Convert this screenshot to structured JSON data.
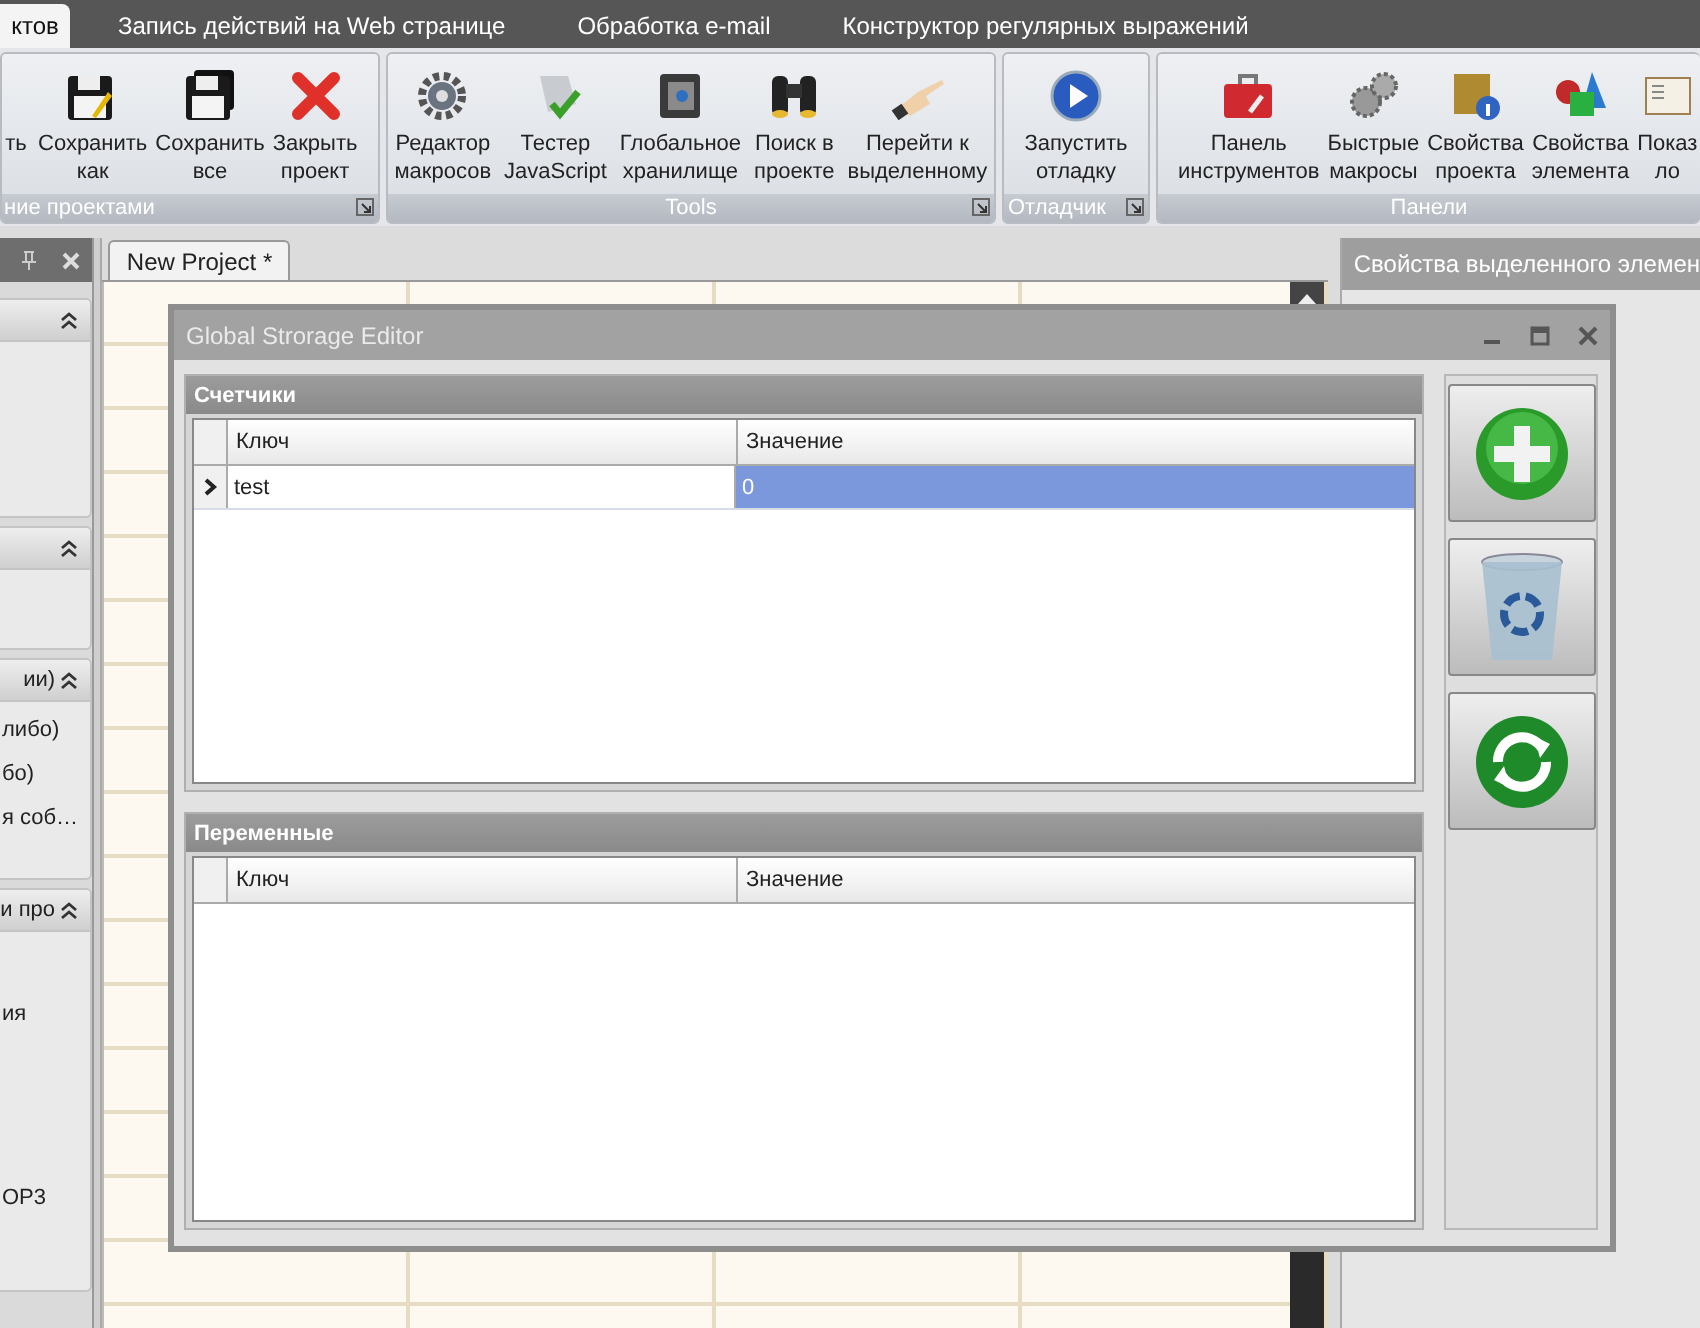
{
  "top_tabs": [
    {
      "label": "ктов",
      "selected": true
    },
    {
      "label": "Запись действий на Web странице",
      "selected": false
    },
    {
      "label": "Обработка e-mail",
      "selected": false
    },
    {
      "label": "Конструктор регулярных выражений",
      "selected": false
    }
  ],
  "ribbon": {
    "groups": [
      {
        "label": "ние проектами",
        "launcher": true,
        "items": [
          {
            "kind": "none",
            "label": "ть"
          },
          {
            "kind": "save",
            "label": "Сохранить\nкак"
          },
          {
            "kind": "save-all",
            "label": "Сохранить\nвсе"
          },
          {
            "kind": "close",
            "label": "Закрыть\nпроект"
          }
        ]
      },
      {
        "label": "Tools",
        "launcher": true,
        "items": [
          {
            "kind": "gear",
            "label": "Редактор\nмакросов"
          },
          {
            "kind": "tester",
            "label": "Тестер\nJavaScript"
          },
          {
            "kind": "safe",
            "label": "Глобальное\nхранилище"
          },
          {
            "kind": "binoculars",
            "label": "Поиск в\nпроекте"
          },
          {
            "kind": "hand",
            "label": "Перейти к\nвыделенному"
          }
        ]
      },
      {
        "label": "Отладчик",
        "launcher": true,
        "items": [
          {
            "kind": "play",
            "label": "Запустить\nотладку"
          }
        ]
      },
      {
        "label": "Панели",
        "launcher": false,
        "items": [
          {
            "kind": "toolbox",
            "label": "Панель\nинструментов"
          },
          {
            "kind": "gears",
            "label": "Быстрые\nмакросы"
          },
          {
            "kind": "crate",
            "label": "Свойства\nпроекта"
          },
          {
            "kind": "shapes",
            "label": "Свойства\nэлемента"
          },
          {
            "kind": "book",
            "label": "Показ\nло"
          }
        ]
      }
    ]
  },
  "left_panel": {
    "sections": [
      {
        "expanded": true
      },
      {
        "expanded": true
      },
      {
        "title": "ии)",
        "expanded": true,
        "items": [
          "либо)",
          "бо)",
          "я соб…"
        ]
      },
      {
        "title": "и про",
        "expanded": true,
        "items": [
          "ия",
          "ОР3"
        ]
      }
    ]
  },
  "document": {
    "tab": {
      "label": "New Project *",
      "selected": true
    }
  },
  "right_panel": {
    "title": "Свойства выделенного элемен"
  },
  "dialog": {
    "title": "Global Strorage Editor",
    "groups": [
      {
        "title": "Счетчики",
        "columns": [
          "Ключ",
          "Значение"
        ],
        "rows": [
          {
            "key": "test",
            "value": "0",
            "selected": true
          }
        ]
      },
      {
        "title": "Переменные",
        "columns": [
          "Ключ",
          "Значение"
        ]
      }
    ],
    "buttons": [
      {
        "kind": "add"
      },
      {
        "kind": "delete"
      },
      {
        "kind": "refresh"
      }
    ]
  }
}
